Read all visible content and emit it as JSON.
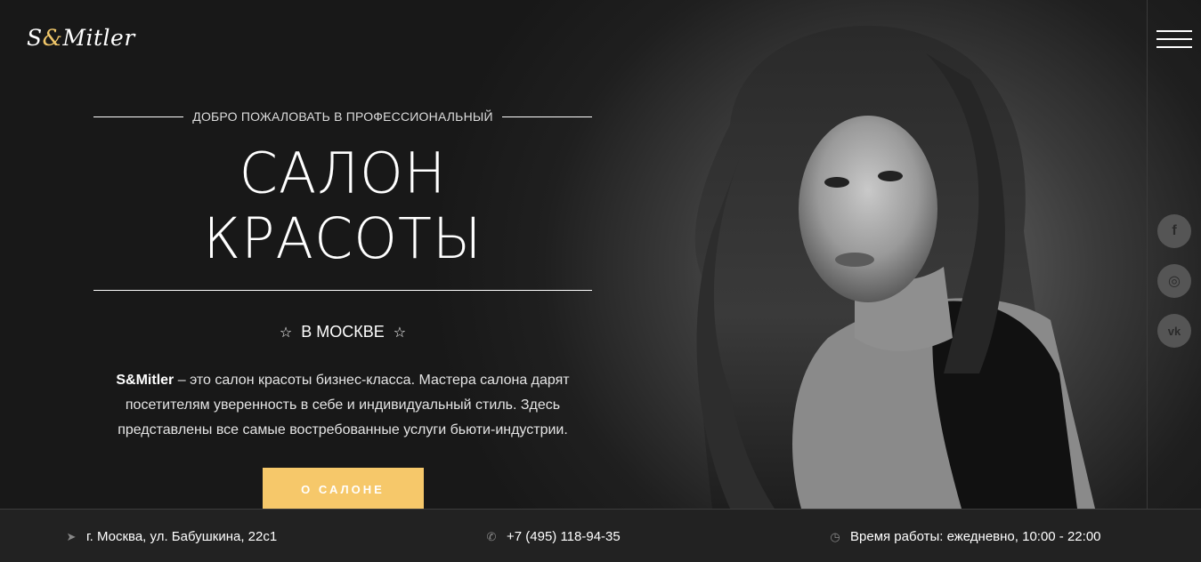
{
  "logo": {
    "prefix": "S",
    "amp": "&",
    "suffix": "Mitler"
  },
  "menu_icon": "hamburger-icon",
  "intro": {
    "welcome": "ДОБРО ПОЖАЛОВАТЬ В ПРОФЕССИОНАЛЬНЫЙ",
    "title": "САЛОН КРАСОТЫ",
    "city": "В МОСКВЕ",
    "star": "☆",
    "brand": "S&Mitler",
    "description": " – это салон красоты бизнес-класса. Мастера салона дарят посетителям уверенность в себе и индивидуальный стиль. Здесь представлены все самые востребованные услуги бьюти-индустрии.",
    "button_label": "О САЛОНЕ"
  },
  "social": [
    {
      "name": "facebook-icon",
      "glyph": "f"
    },
    {
      "name": "instagram-icon",
      "glyph": "◎"
    },
    {
      "name": "vk-icon",
      "glyph": "vk"
    }
  ],
  "footer": {
    "address": "г. Москва, ул. Бабушкина, 22с1",
    "phone": "+7 (495) 118-94-35",
    "hours": "Время работы: ежедневно, 10:00 - 22:00",
    "address_icon": "location-arrow-icon",
    "phone_icon": "phone-icon",
    "hours_icon": "clock-icon"
  },
  "colors": {
    "accent": "#f6c86a",
    "background": "#1b1b1b",
    "footer": "#222222"
  }
}
